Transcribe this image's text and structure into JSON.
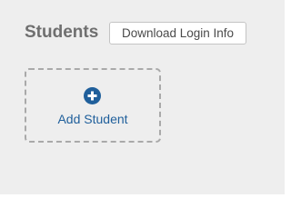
{
  "header": {
    "title": "Students",
    "download_button_label": "Download Login Info"
  },
  "add_card": {
    "icon": "plus-circle-icon",
    "label": "Add Student"
  },
  "colors": {
    "accent": "#1f5f9b",
    "title_text": "#6f6f6f",
    "panel_background": "#eeeeee",
    "dashed_border": "#a9a9a9"
  }
}
